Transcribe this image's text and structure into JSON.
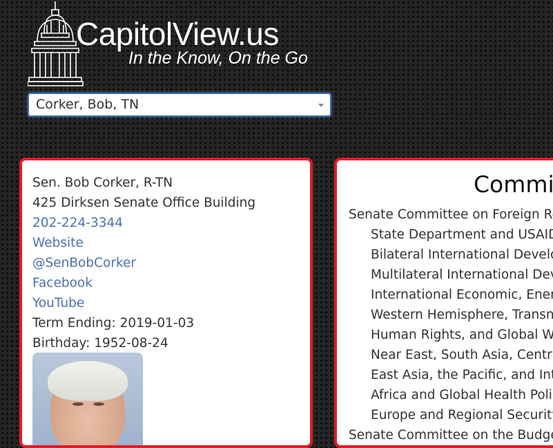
{
  "header": {
    "brand": "CapitolView.us",
    "tagline": "In the Know, On the Go"
  },
  "selector": {
    "value": "Corker, Bob, TN"
  },
  "profile": {
    "name": "Sen. Bob Corker, R-TN",
    "office": "425 Dirksen Senate Office Building",
    "phone": "202-224-3344",
    "website": "Website",
    "twitter": "@SenBobCorker",
    "facebook": "Facebook",
    "youtube": "YouTube",
    "term": "Term Ending: 2019-01-03",
    "birthday": "Birthday: 1952-08-24"
  },
  "committees": {
    "title": "Committees",
    "items": [
      {
        "label": "Senate Committee on Foreign Relations",
        "sub": false
      },
      {
        "label": "State Department and USAID Management",
        "sub": true
      },
      {
        "label": "Bilateral International Development",
        "sub": true
      },
      {
        "label": "Multilateral International Development",
        "sub": true
      },
      {
        "label": "International Economic, Energy",
        "sub": true
      },
      {
        "label": "Western Hemisphere, Transnational",
        "sub": true
      },
      {
        "label": "Human Rights, and Global Women's",
        "sub": true
      },
      {
        "label": "Near East, South Asia, Central Asia",
        "sub": true
      },
      {
        "label": "East Asia, the Pacific, and International",
        "sub": true
      },
      {
        "label": "Africa and Global Health Policy",
        "sub": true
      },
      {
        "label": "Europe and Regional Security Cooperation",
        "sub": true
      },
      {
        "label": "Senate Committee on the Budget",
        "sub": false
      }
    ]
  },
  "colors": {
    "card_border": "#e11b2a",
    "link": "#4a72b5",
    "select_border": "#3c6aa9"
  }
}
